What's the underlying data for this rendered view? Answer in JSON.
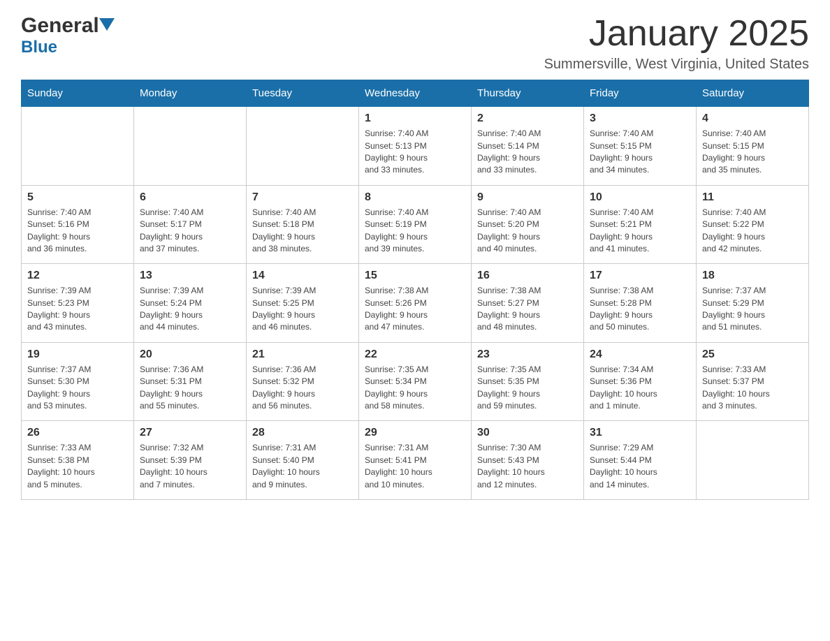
{
  "header": {
    "logo_general": "General",
    "logo_blue": "Blue",
    "title": "January 2025",
    "subtitle": "Summersville, West Virginia, United States"
  },
  "days_of_week": [
    "Sunday",
    "Monday",
    "Tuesday",
    "Wednesday",
    "Thursday",
    "Friday",
    "Saturday"
  ],
  "weeks": [
    [
      {
        "day": "",
        "info": ""
      },
      {
        "day": "",
        "info": ""
      },
      {
        "day": "",
        "info": ""
      },
      {
        "day": "1",
        "info": "Sunrise: 7:40 AM\nSunset: 5:13 PM\nDaylight: 9 hours\nand 33 minutes."
      },
      {
        "day": "2",
        "info": "Sunrise: 7:40 AM\nSunset: 5:14 PM\nDaylight: 9 hours\nand 33 minutes."
      },
      {
        "day": "3",
        "info": "Sunrise: 7:40 AM\nSunset: 5:15 PM\nDaylight: 9 hours\nand 34 minutes."
      },
      {
        "day": "4",
        "info": "Sunrise: 7:40 AM\nSunset: 5:15 PM\nDaylight: 9 hours\nand 35 minutes."
      }
    ],
    [
      {
        "day": "5",
        "info": "Sunrise: 7:40 AM\nSunset: 5:16 PM\nDaylight: 9 hours\nand 36 minutes."
      },
      {
        "day": "6",
        "info": "Sunrise: 7:40 AM\nSunset: 5:17 PM\nDaylight: 9 hours\nand 37 minutes."
      },
      {
        "day": "7",
        "info": "Sunrise: 7:40 AM\nSunset: 5:18 PM\nDaylight: 9 hours\nand 38 minutes."
      },
      {
        "day": "8",
        "info": "Sunrise: 7:40 AM\nSunset: 5:19 PM\nDaylight: 9 hours\nand 39 minutes."
      },
      {
        "day": "9",
        "info": "Sunrise: 7:40 AM\nSunset: 5:20 PM\nDaylight: 9 hours\nand 40 minutes."
      },
      {
        "day": "10",
        "info": "Sunrise: 7:40 AM\nSunset: 5:21 PM\nDaylight: 9 hours\nand 41 minutes."
      },
      {
        "day": "11",
        "info": "Sunrise: 7:40 AM\nSunset: 5:22 PM\nDaylight: 9 hours\nand 42 minutes."
      }
    ],
    [
      {
        "day": "12",
        "info": "Sunrise: 7:39 AM\nSunset: 5:23 PM\nDaylight: 9 hours\nand 43 minutes."
      },
      {
        "day": "13",
        "info": "Sunrise: 7:39 AM\nSunset: 5:24 PM\nDaylight: 9 hours\nand 44 minutes."
      },
      {
        "day": "14",
        "info": "Sunrise: 7:39 AM\nSunset: 5:25 PM\nDaylight: 9 hours\nand 46 minutes."
      },
      {
        "day": "15",
        "info": "Sunrise: 7:38 AM\nSunset: 5:26 PM\nDaylight: 9 hours\nand 47 minutes."
      },
      {
        "day": "16",
        "info": "Sunrise: 7:38 AM\nSunset: 5:27 PM\nDaylight: 9 hours\nand 48 minutes."
      },
      {
        "day": "17",
        "info": "Sunrise: 7:38 AM\nSunset: 5:28 PM\nDaylight: 9 hours\nand 50 minutes."
      },
      {
        "day": "18",
        "info": "Sunrise: 7:37 AM\nSunset: 5:29 PM\nDaylight: 9 hours\nand 51 minutes."
      }
    ],
    [
      {
        "day": "19",
        "info": "Sunrise: 7:37 AM\nSunset: 5:30 PM\nDaylight: 9 hours\nand 53 minutes."
      },
      {
        "day": "20",
        "info": "Sunrise: 7:36 AM\nSunset: 5:31 PM\nDaylight: 9 hours\nand 55 minutes."
      },
      {
        "day": "21",
        "info": "Sunrise: 7:36 AM\nSunset: 5:32 PM\nDaylight: 9 hours\nand 56 minutes."
      },
      {
        "day": "22",
        "info": "Sunrise: 7:35 AM\nSunset: 5:34 PM\nDaylight: 9 hours\nand 58 minutes."
      },
      {
        "day": "23",
        "info": "Sunrise: 7:35 AM\nSunset: 5:35 PM\nDaylight: 9 hours\nand 59 minutes."
      },
      {
        "day": "24",
        "info": "Sunrise: 7:34 AM\nSunset: 5:36 PM\nDaylight: 10 hours\nand 1 minute."
      },
      {
        "day": "25",
        "info": "Sunrise: 7:33 AM\nSunset: 5:37 PM\nDaylight: 10 hours\nand 3 minutes."
      }
    ],
    [
      {
        "day": "26",
        "info": "Sunrise: 7:33 AM\nSunset: 5:38 PM\nDaylight: 10 hours\nand 5 minutes."
      },
      {
        "day": "27",
        "info": "Sunrise: 7:32 AM\nSunset: 5:39 PM\nDaylight: 10 hours\nand 7 minutes."
      },
      {
        "day": "28",
        "info": "Sunrise: 7:31 AM\nSunset: 5:40 PM\nDaylight: 10 hours\nand 9 minutes."
      },
      {
        "day": "29",
        "info": "Sunrise: 7:31 AM\nSunset: 5:41 PM\nDaylight: 10 hours\nand 10 minutes."
      },
      {
        "day": "30",
        "info": "Sunrise: 7:30 AM\nSunset: 5:43 PM\nDaylight: 10 hours\nand 12 minutes."
      },
      {
        "day": "31",
        "info": "Sunrise: 7:29 AM\nSunset: 5:44 PM\nDaylight: 10 hours\nand 14 minutes."
      },
      {
        "day": "",
        "info": ""
      }
    ]
  ]
}
